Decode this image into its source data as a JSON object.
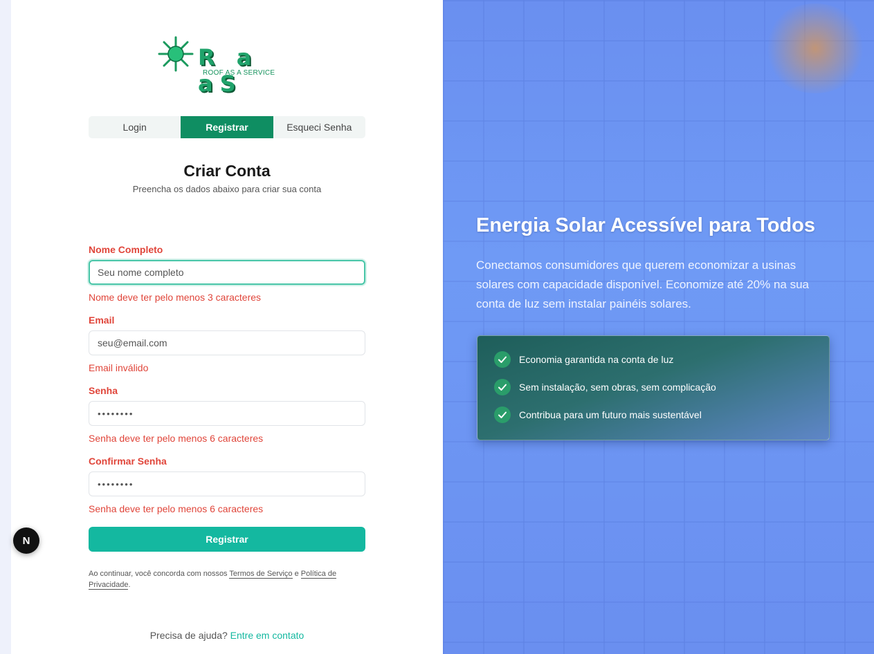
{
  "logo": {
    "wordmark": "R a aS",
    "tagline": "ROOF AS A SERVICE"
  },
  "tabs": [
    {
      "label": "Login",
      "active": false
    },
    {
      "label": "Registrar",
      "active": true
    },
    {
      "label": "Esqueci Senha",
      "active": false
    }
  ],
  "form": {
    "title": "Criar Conta",
    "subtitle": "Preencha os dados abaixo para criar sua conta",
    "fields": [
      {
        "label": "Nome Completo",
        "placeholder": "Seu nome completo",
        "value": "",
        "error": "Nome deve ter pelo menos 3 caracteres"
      },
      {
        "label": "Email",
        "placeholder": "seu@email.com",
        "value": "",
        "error": "Email inválido"
      },
      {
        "label": "Senha",
        "placeholder": "••••••••",
        "value": "",
        "error": "Senha deve ter pelo menos 6 caracteres"
      },
      {
        "label": "Confirmar Senha",
        "placeholder": "••••••••",
        "value": "",
        "error": "Senha deve ter pelo menos 6 caracteres"
      }
    ],
    "submit_label": "Registrar",
    "terms": {
      "prefix": "Ao continuar, você concorda com nossos",
      "terms_link": "Termos de Serviço",
      "conjunction": "e",
      "privacy_link": "Política de Privacidade",
      "suffix": "."
    },
    "help": {
      "text": "Precisa de ajuda?",
      "link": "Entre em contato"
    }
  },
  "dev_badge": "N",
  "hero": {
    "title": "Energia Solar Acessível para Todos",
    "text": "Conectamos consumidores que querem economizar a usinas solares com capacidade disponível. Economize até 20% na sua conta de luz sem instalar painéis solares.",
    "features": [
      "Economia garantida na conta de luz",
      "Sem instalação, sem obras, sem complicação",
      "Contribua para um futuro mais sustentável"
    ]
  },
  "colors": {
    "brand_green": "#0f8e62",
    "accent_teal": "#14b8a0",
    "error_red": "#e0453a",
    "hero_blue": "#6a8ff0"
  }
}
